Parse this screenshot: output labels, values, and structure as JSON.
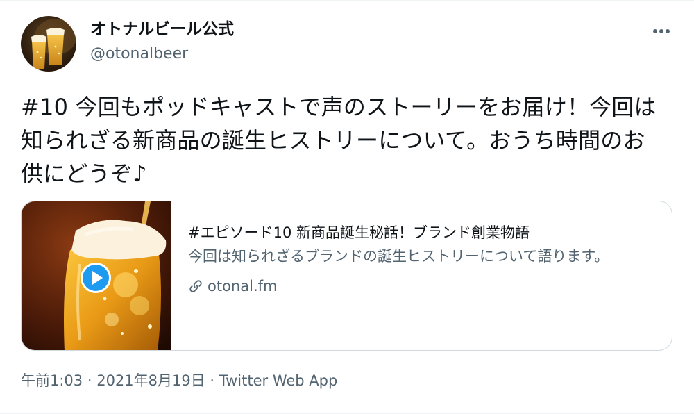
{
  "author": {
    "display_name": "オトナルビール公式",
    "handle": "@otonalbeer",
    "avatar_icon": "beer-glasses-avatar"
  },
  "tweet": {
    "text": "#10 今回もポッドキャストで声のストーリーをお届け！今回は知られざる新商品の誕生ヒストリーについて。おうち時間のお供にどうぞ♪"
  },
  "card": {
    "title": "#エピソード10 新商品誕生秘話！ブランド創業物語",
    "description": "今回は知られざるブランドの誕生ヒストリーについて語ります。",
    "domain": "otonal.fm",
    "media_icon": "beer-glass-image",
    "play_icon": "play-icon",
    "link_icon": "link-icon"
  },
  "meta": {
    "time": "午前1:03",
    "separator1": " · ",
    "date": "2021年8月19日",
    "separator2": " · ",
    "source": "Twitter Web App"
  },
  "menu": {
    "more_icon": "more-dots-icon"
  },
  "colors": {
    "text_primary": "#0f1419",
    "text_secondary": "#536471",
    "border": "#cfd9de",
    "play_blue": "#1d9bf0"
  }
}
